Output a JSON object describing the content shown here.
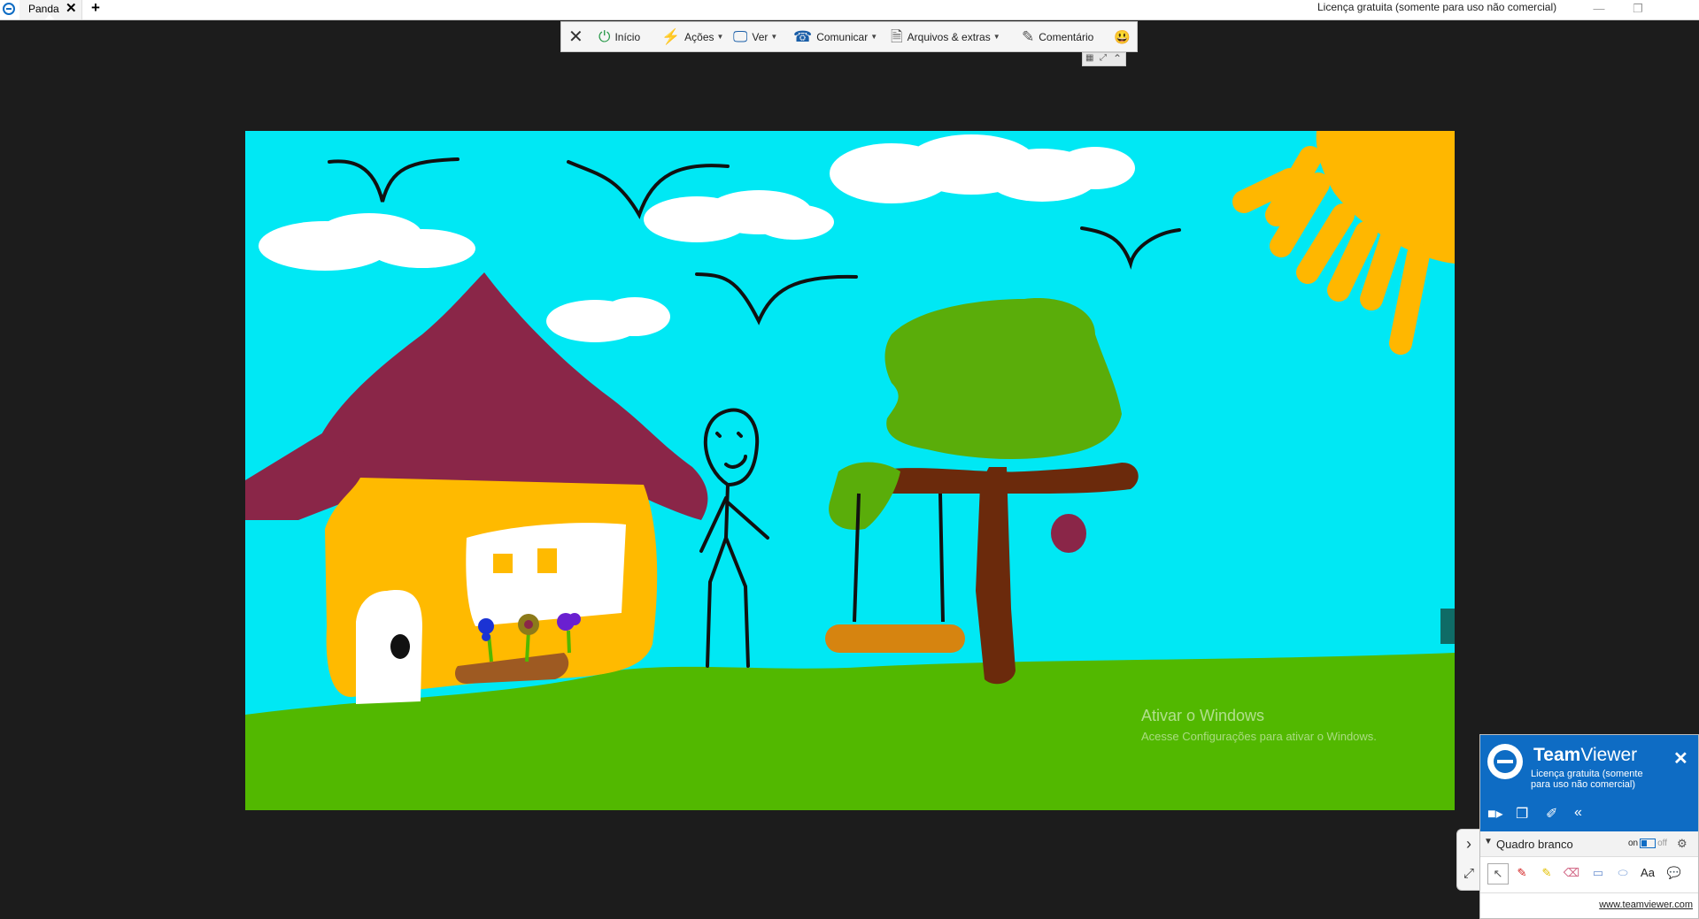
{
  "titlebar": {
    "tab_label": "Panda",
    "tab_close": "✕",
    "new_tab": "+",
    "license_text": "Licença gratuita (somente para uso não comercial)",
    "minimize": "—",
    "restore": "❐"
  },
  "toolbar": {
    "close": "✕",
    "items": [
      {
        "label": "Início",
        "icon": "power-icon"
      },
      {
        "label": "Ações",
        "icon": "lightning-icon"
      },
      {
        "label": "Ver",
        "icon": "monitor-icon"
      },
      {
        "label": "Comunicar",
        "icon": "phone-icon"
      },
      {
        "label": "Arquivos & extras",
        "icon": "file-icon"
      },
      {
        "label": "Comentário",
        "icon": "edit-icon"
      }
    ],
    "smiley": "😃"
  },
  "remote": {
    "watermark_title": "Ativar o Windows",
    "watermark_sub": "Acesse Configurações para ativar o Windows."
  },
  "side": {
    "collapse": "›",
    "expand": "⤢"
  },
  "tv_panel": {
    "brand_bold": "Team",
    "brand_rest": "Viewer",
    "license": "Licença gratuita (somente para uso não comercial)",
    "close": "✕",
    "whiteboard_label": "Quadro branco",
    "toggle_on": "on",
    "toggle_off": "off",
    "link": "www.teamviewer.com"
  },
  "colors": {
    "sky": "#00e8f4",
    "grass": "#52b800",
    "roof": "#8a2648",
    "house": "#ffba00",
    "sun": "#ffb700",
    "tree_leaves": "#5aad0a",
    "tree_trunk": "#6b2a0c",
    "tv_blue": "#0e6cc4"
  }
}
